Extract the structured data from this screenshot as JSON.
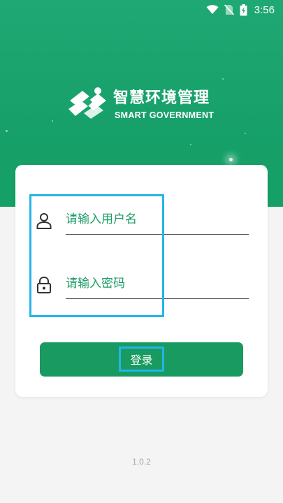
{
  "status_bar": {
    "time": "3:56",
    "icons": [
      "wifi-icon",
      "no-sim-icon",
      "battery-charging-icon"
    ]
  },
  "brand": {
    "logo_icon": "smart-government-logo-icon",
    "title": "智慧环境管理",
    "subtitle": "SMART GOVERNMENT"
  },
  "form": {
    "username": {
      "placeholder": "请输入用户名",
      "value": "",
      "icon": "user-icon"
    },
    "password": {
      "placeholder": "请输入密码",
      "value": "",
      "icon": "lock-icon"
    },
    "login_label": "登录"
  },
  "footer": {
    "version": "1.0.2"
  },
  "colors": {
    "primary": "#189a60",
    "header_green": "#1fa873",
    "highlight": "#22b5e8",
    "background": "#f4f4f4"
  }
}
